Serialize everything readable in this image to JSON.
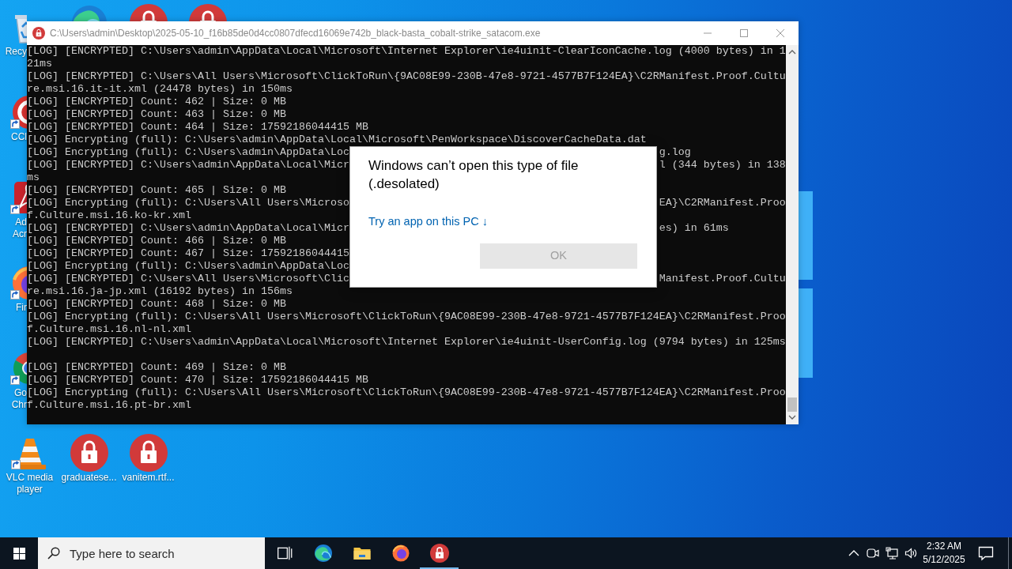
{
  "desktop": {
    "left_column": [
      {
        "kind": "recycle-bin",
        "label": [
          "Recy"
        ],
        "shortcut": false
      },
      {
        "kind": "ccleaner",
        "label": [
          "CCl"
        ],
        "shortcut": true
      },
      {
        "kind": "acrobat",
        "label": [
          "Ad",
          "Acr"
        ],
        "shortcut": true
      },
      {
        "kind": "firefox",
        "label": [
          "Fir"
        ],
        "shortcut": true
      },
      {
        "kind": "chrome",
        "label": [
          "Go",
          "Chr"
        ],
        "shortcut": true
      }
    ],
    "top_row": [
      {
        "kind": "edge"
      },
      {
        "kind": "locked-file"
      },
      {
        "kind": "locked-file"
      }
    ],
    "bottom_row": [
      {
        "kind": "vlc",
        "label": [
          "VLC media player"
        ],
        "shortcut": true
      },
      {
        "kind": "locked-file",
        "label": [
          "graduatese..."
        ],
        "shortcut": false
      },
      {
        "kind": "locked-file",
        "label": [
          "vanitem.rtf..."
        ],
        "shortcut": false
      }
    ]
  },
  "console_window": {
    "title": "C:\\Users\\admin\\Desktop\\2025-05-10_f16b85de0d4cc0807dfecd16069e742b_black-basta_cobalt-strike_satacom.exe",
    "lines": [
      {
        "kind": "text",
        "text": "[LOG] [ENCRYPTED] C:\\Users\\admin\\AppData\\Local\\Microsoft\\Internet Explorer\\ie4uinit-ClearIconCache.log (4000 bytes) in 1"
      },
      {
        "kind": "text",
        "text": "21ms"
      },
      {
        "kind": "text",
        "text": "[LOG] [ENCRYPTED] C:\\Users\\All Users\\Microsoft\\ClickToRun\\{9AC08E99-230B-47e8-9721-4577B7F124EA}\\C2RManifest.Proof.Cultu"
      },
      {
        "kind": "text",
        "text": "re.msi.16.it-it.xml (24478 bytes) in 150ms"
      },
      {
        "kind": "text",
        "text": "[LOG] [ENCRYPTED] Count: 462 | Size: 0 MB"
      },
      {
        "kind": "text",
        "text": "[LOG] [ENCRYPTED] Count: 463 | Size: 0 MB"
      },
      {
        "kind": "text",
        "text": "[LOG] [ENCRYPTED] Count: 464 | Size: 17592186044415 MB"
      },
      {
        "kind": "text",
        "text": "[LOG] Encrypting (full): C:\\Users\\admin\\AppData\\Local\\Microsoft\\PenWorkspace\\DiscoverCacheData.dat"
      },
      {
        "kind": "split",
        "text": "[LOG] Encrypting (full): C:\\Users\\admin\\AppData\\Loc",
        "text_right": "g.log"
      },
      {
        "kind": "split",
        "text": "[LOG] [ENCRYPTED] C:\\Users\\admin\\AppData\\Local\\Micr",
        "text_right": "l (344 bytes) in 138"
      },
      {
        "kind": "text",
        "text": "ms"
      },
      {
        "kind": "text",
        "text": "[LOG] [ENCRYPTED] Count: 465 | Size: 0 MB"
      },
      {
        "kind": "split",
        "text": "[LOG] Encrypting (full): C:\\Users\\All Users\\Microso",
        "text_right": "EA}\\C2RManifest.Proo"
      },
      {
        "kind": "text",
        "text": "f.Culture.msi.16.ko-kr.xml"
      },
      {
        "kind": "split",
        "text": "[LOG] [ENCRYPTED] C:\\Users\\admin\\AppData\\Local\\Micr",
        "text_right": "es) in 61ms"
      },
      {
        "kind": "text",
        "text": "[LOG] [ENCRYPTED] Count: 466 | Size: 0 MB"
      },
      {
        "kind": "text",
        "text": "[LOG] [ENCRYPTED] Count: 467 | Size: 17592186044415"
      },
      {
        "kind": "text",
        "text": "[LOG] Encrypting (full): C:\\Users\\admin\\AppData\\Loc"
      },
      {
        "kind": "split",
        "text": "[LOG] [ENCRYPTED] C:\\Users\\All Users\\Microsoft\\Clic",
        "text_right": "Manifest.Proof.Cultu"
      },
      {
        "kind": "text",
        "text": "re.msi.16.ja-jp.xml (16192 bytes) in 156ms"
      },
      {
        "kind": "text",
        "text": "[LOG] [ENCRYPTED] Count: 468 | Size: 0 MB"
      },
      {
        "kind": "text",
        "text": "[LOG] Encrypting (full): C:\\Users\\All Users\\Microsoft\\ClickToRun\\{9AC08E99-230B-47e8-9721-4577B7F124EA}\\C2RManifest.Proo"
      },
      {
        "kind": "text",
        "text": "f.Culture.msi.16.nl-nl.xml"
      },
      {
        "kind": "text",
        "text": "[LOG] [ENCRYPTED] C:\\Users\\admin\\AppData\\Local\\Microsoft\\Internet Explorer\\ie4uinit-UserConfig.log (9794 bytes) in 125ms"
      },
      {
        "kind": "blank"
      },
      {
        "kind": "text",
        "text": "[LOG] [ENCRYPTED] Count: 469 | Size: 0 MB"
      },
      {
        "kind": "text",
        "text": "[LOG] [ENCRYPTED] Count: 470 | Size: 17592186044415 MB"
      },
      {
        "kind": "text",
        "text": "[LOG] Encrypting (full): C:\\Users\\All Users\\Microsoft\\ClickToRun\\{9AC08E99-230B-47e8-9721-4577B7F124EA}\\C2RManifest.Proo"
      },
      {
        "kind": "text",
        "text": "f.Culture.msi.16.pt-br.xml"
      }
    ]
  },
  "dialog": {
    "message": "Windows can’t open this type of file (.desolated)",
    "link": "Try an app on this PC ↓",
    "ok_button": {
      "label": "OK",
      "disabled": true
    }
  },
  "taskbar": {
    "search": {
      "placeholder": "Type here to search"
    },
    "apps": [
      {
        "kind": "task-view",
        "running": false
      },
      {
        "kind": "edge",
        "running": false
      },
      {
        "kind": "explorer",
        "running": false
      },
      {
        "kind": "firefox",
        "running": false
      },
      {
        "kind": "locked-file",
        "running": true
      }
    ],
    "clock": {
      "time": "2:32 AM",
      "date": "5/12/2025"
    }
  }
}
